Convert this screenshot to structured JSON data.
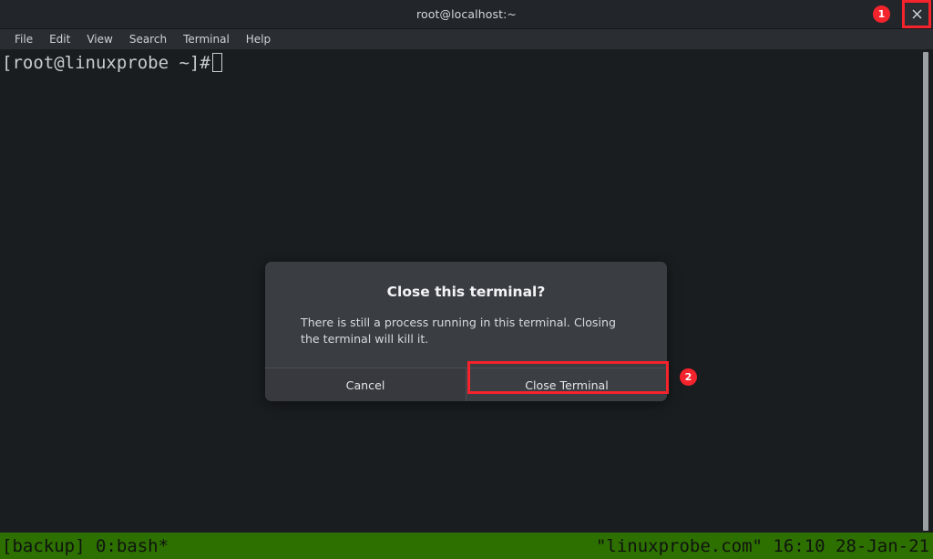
{
  "window": {
    "title": "root@localhost:~",
    "close_icon": "close-icon"
  },
  "annotations": [
    {
      "label": "1",
      "target": "window-close-button"
    },
    {
      "label": "2",
      "target": "close-terminal-button"
    }
  ],
  "menubar": {
    "items": [
      {
        "label": "File"
      },
      {
        "label": "Edit"
      },
      {
        "label": "View"
      },
      {
        "label": "Search"
      },
      {
        "label": "Terminal"
      },
      {
        "label": "Help"
      }
    ]
  },
  "terminal": {
    "prompt": "[root@linuxprobe ~]#",
    "cursor": "block-cursor-unfocused",
    "background": "#191d1f",
    "foreground": "#c9cdd0"
  },
  "statusbar": {
    "left": "[backup] 0:bash*",
    "right": "\"linuxprobe.com\" 16:10 28-Jan-21",
    "background": "#2d7000",
    "foreground": "#101310"
  },
  "dialog": {
    "title": "Close this terminal?",
    "message": "There is still a process running in this terminal. Closing the terminal will kill it.",
    "buttons": {
      "cancel": "Cancel",
      "confirm": "Close Terminal"
    },
    "highlight_color": "#f4232c",
    "background": "#3a3e43"
  }
}
